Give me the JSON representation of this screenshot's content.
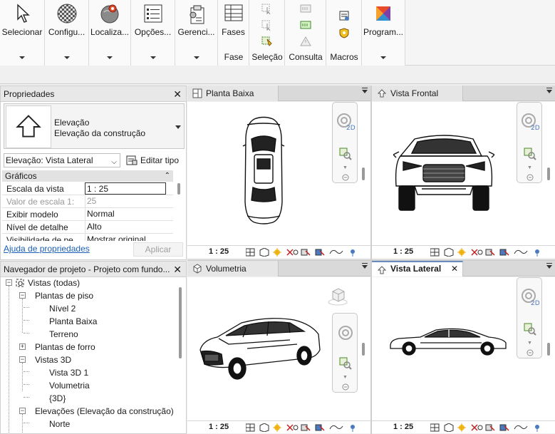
{
  "ribbon": {
    "large_buttons": [
      {
        "label": "Selecionar",
        "icon": "cursor-arrow-icon"
      },
      {
        "label": "Configu...",
        "icon": "material-sphere-icon"
      },
      {
        "label": "Localiza...",
        "icon": "globe-location-icon"
      },
      {
        "label": "Opções...",
        "icon": "options-list-icon"
      },
      {
        "label": "Gerenci...",
        "icon": "manage-clipboard-icon"
      }
    ],
    "fases_label": "Fases",
    "group_fase": "Fase",
    "group_selecao": "Seleção",
    "group_consulta": "Consulta",
    "group_macros": "Macros",
    "program_label": "Program..."
  },
  "properties": {
    "title": "Propriedades",
    "type_line1": "Elevação",
    "type_line2": "Elevação da construção",
    "instance_select": "Elevação: Vista Lateral",
    "edit_type": "Editar tipo",
    "group_name": "Gráficos",
    "rows": [
      {
        "key": "Escala da vista",
        "value": "1 : 25"
      },
      {
        "key": "Valor de escala   1:",
        "value": "25"
      },
      {
        "key": "Exibir modelo",
        "value": "Normal"
      },
      {
        "key": "Nível de detalhe",
        "value": "Alto"
      },
      {
        "key": "Visibilidade de pe...",
        "value": "Mostrar original"
      }
    ],
    "help_link": "Ajuda de propriedades",
    "apply": "Aplicar"
  },
  "browser": {
    "title": "Navegador de projeto - Projeto com fundo...",
    "nodes": {
      "views": "Vistas (todas)",
      "floor_plans": "Plantas de piso",
      "nivel2": "Nível 2",
      "planta_baixa": "Planta Baixa",
      "terreno": "Terreno",
      "ceiling_plans": "Plantas de forro",
      "views3d": "Vistas 3D",
      "vista3d1": "Vista 3D 1",
      "volumetria": "Volumetria",
      "default3d": "{3D}",
      "elevations": "Elevações (Elevação da construção)",
      "norte": "Norte"
    }
  },
  "views": {
    "planta_baixa": {
      "title": "Planta Baixa",
      "scale": "1 : 25"
    },
    "vista_frontal": {
      "title": "Vista Frontal",
      "scale": "1 : 25"
    },
    "volumetria": {
      "title": "Volumetria",
      "scale": "1 : 25"
    },
    "vista_lateral": {
      "title": "Vista Lateral",
      "scale": "1 : 25"
    }
  }
}
